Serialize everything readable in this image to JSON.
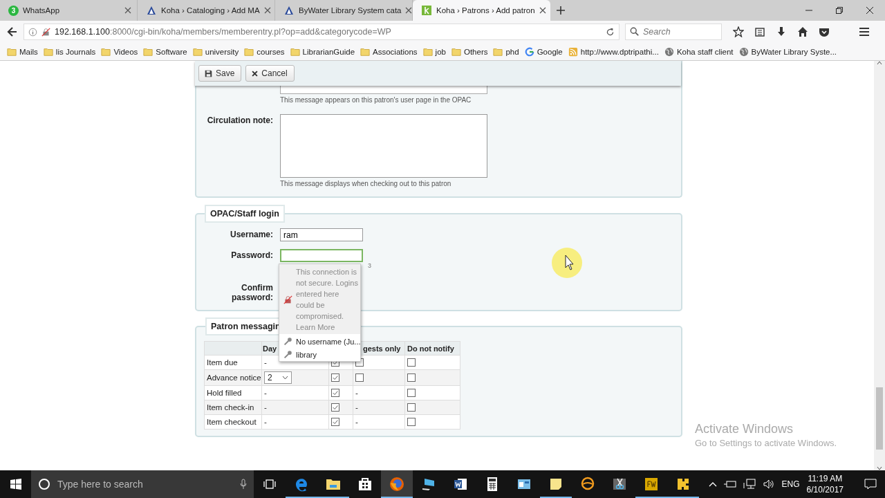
{
  "browser": {
    "tabs": [
      {
        "title": "WhatsApp",
        "badge": "3",
        "kind": "badge",
        "selected": false
      },
      {
        "title": "Koha › Cataloging › Add MA",
        "kind": "sail",
        "selected": false
      },
      {
        "title": "ByWater Library System cata",
        "kind": "sail",
        "selected": false
      },
      {
        "title": "Koha › Patrons › Add patron",
        "kind": "koha",
        "selected": true
      }
    ],
    "address": {
      "host": "192.168.1.100",
      "path": ":8000/cgi-bin/koha/members/memberentry.pl?op=add&categorycode=WP"
    },
    "search": {
      "placeholder": "Search"
    },
    "bookmarks": [
      {
        "label": "Mails",
        "kind": "folder"
      },
      {
        "label": "lis Journals",
        "kind": "folder"
      },
      {
        "label": "Videos",
        "kind": "folder"
      },
      {
        "label": "Software",
        "kind": "folder"
      },
      {
        "label": "university",
        "kind": "folder"
      },
      {
        "label": "courses",
        "kind": "folder"
      },
      {
        "label": "LibrarianGuide",
        "kind": "folder"
      },
      {
        "label": "Associations",
        "kind": "folder"
      },
      {
        "label": "job",
        "kind": "folder"
      },
      {
        "label": "Others",
        "kind": "folder"
      },
      {
        "label": "phd",
        "kind": "folder"
      },
      {
        "label": "Google",
        "kind": "google"
      },
      {
        "label": "http://www.dptripathi...",
        "kind": "feed"
      },
      {
        "label": "Koha staff client",
        "kind": "globe"
      },
      {
        "label": "ByWater Library Syste...",
        "kind": "globe"
      }
    ]
  },
  "toolbar": {
    "buttons": [
      {
        "label": "Save",
        "kind": "save"
      },
      {
        "label": "Cancel",
        "kind": "cancel"
      }
    ]
  },
  "notes_section": {
    "opac_note_hint": "This message appears on this patron's user page in the OPAC",
    "circulation_note": {
      "label": "Circulation note:",
      "hint": "This message displays when checking out to this patron"
    }
  },
  "login_section": {
    "legend": "OPAC/Staff login",
    "username": {
      "label": "Username:",
      "value": "ram"
    },
    "password": {
      "label": "Password:",
      "focused": true
    },
    "password_hint_fragment": "3",
    "confirm_label": "Confirm password:"
  },
  "password_popup": {
    "warning": "This connection is not secure. Logins entered here could be compromised.",
    "link": "Learn More",
    "logins": [
      "No username (Ju...",
      "library"
    ]
  },
  "messaging_section": {
    "legend": "Patron messagin",
    "columns": [
      {
        "kind": "blank"
      },
      {
        "kind": "text",
        "label": "Day"
      },
      {
        "kind": "blank"
      },
      {
        "kind": "text",
        "label": "gests only"
      },
      {
        "kind": "text",
        "label": "Do not notify"
      }
    ],
    "rows": [
      {
        "label": "Item due",
        "cells": [
          {
            "kind": "text",
            "text": "-"
          },
          {
            "kind": "checkbox",
            "checked": true
          },
          {
            "kind": "checkbox",
            "checked": false
          },
          {
            "kind": "checkbox",
            "checked": false
          }
        ]
      },
      {
        "label": "Advance notice",
        "cells": [
          {
            "kind": "select",
            "value": "2"
          },
          {
            "kind": "checkbox",
            "checked": true
          },
          {
            "kind": "checkbox",
            "checked": false
          },
          {
            "kind": "checkbox",
            "checked": false
          }
        ]
      },
      {
        "label": "Hold filled",
        "cells": [
          {
            "kind": "text",
            "text": "-"
          },
          {
            "kind": "checkbox",
            "checked": true
          },
          {
            "kind": "text",
            "text": "-"
          },
          {
            "kind": "checkbox",
            "checked": false
          }
        ]
      },
      {
        "label": "Item check-in",
        "cells": [
          {
            "kind": "text",
            "text": "-"
          },
          {
            "kind": "checkbox",
            "checked": true
          },
          {
            "kind": "text",
            "text": "-"
          },
          {
            "kind": "checkbox",
            "checked": false
          }
        ]
      },
      {
        "label": "Item checkout",
        "cells": [
          {
            "kind": "text",
            "text": "-"
          },
          {
            "kind": "checkbox",
            "checked": true
          },
          {
            "kind": "text",
            "text": "-"
          },
          {
            "kind": "checkbox",
            "checked": false
          }
        ]
      }
    ]
  },
  "activation_notice": {
    "title": "Activate Windows",
    "subtitle": "Go to Settings to activate Windows."
  },
  "taskbar": {
    "search": {
      "placeholder": "Type here to search"
    },
    "apps": [
      {
        "kind": "edge",
        "running": true,
        "active": false
      },
      {
        "kind": "folder",
        "running": true,
        "active": false
      },
      {
        "kind": "store",
        "running": false,
        "active": false
      },
      {
        "kind": "firefox",
        "running": true,
        "active": true
      },
      {
        "kind": "monitor",
        "running": false,
        "active": false
      },
      {
        "kind": "word",
        "running": false,
        "active": false
      },
      {
        "kind": "calculator",
        "running": false,
        "active": false
      },
      {
        "kind": "screen",
        "running": false,
        "active": false
      },
      {
        "kind": "note",
        "running": true,
        "active": false
      },
      {
        "kind": "mail",
        "running": false,
        "active": false
      },
      {
        "kind": "scissors",
        "running": false,
        "active": false
      },
      {
        "kind": "fw",
        "running": true,
        "active": false
      },
      {
        "kind": "puzzle",
        "running": true,
        "active": false
      }
    ],
    "language": "ENG",
    "time": "11:19 AM",
    "date": "6/10/2017"
  }
}
